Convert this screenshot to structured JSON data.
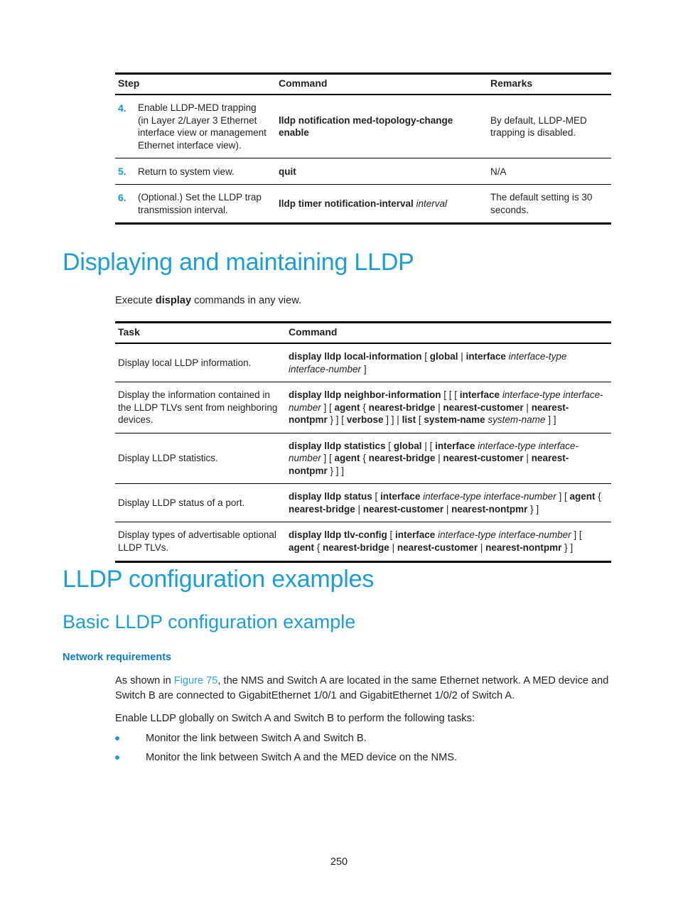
{
  "page": {
    "number": "250"
  },
  "steps_table": {
    "columns": [
      "Step",
      "Command",
      "Remarks"
    ],
    "rows": [
      {
        "num": "4.",
        "step": "Enable LLDP-MED trapping (in Layer 2/Layer 3 Ethernet interface view or management Ethernet interface view).",
        "command": "lldp notification med-topology-change enable",
        "remarks": "By default, LLDP-MED trapping is disabled."
      },
      {
        "num": "5.",
        "step": "Return to system view.",
        "command": "quit",
        "remarks": "N/A"
      },
      {
        "num": "6.",
        "step": "(Optional.) Set the LLDP trap transmission interval.",
        "command_bold": "lldp timer notification-interval",
        "command_var": "interval",
        "remarks": "The default setting is 30 seconds."
      }
    ]
  },
  "section_display": {
    "heading": "Displaying and maintaining LLDP",
    "intro_pre": "Execute ",
    "intro_bold": "display",
    "intro_post": " commands in any view."
  },
  "display_table": {
    "columns": [
      "Task",
      "Command"
    ],
    "rows": [
      {
        "task": "Display local LLDP information.",
        "command_parts": [
          {
            "t": "display lldp local-information",
            "s": "b"
          },
          {
            "t": " [ ",
            "s": "n"
          },
          {
            "t": "global",
            "s": "b"
          },
          {
            "t": " | ",
            "s": "n"
          },
          {
            "t": "interface",
            "s": "b"
          },
          {
            "t": " ",
            "s": "n"
          },
          {
            "t": "interface-type interface-number",
            "s": "i"
          },
          {
            "t": " ]",
            "s": "n"
          }
        ]
      },
      {
        "task": "Display the information contained in the LLDP TLVs sent from neighboring devices.",
        "command_parts": [
          {
            "t": "display lldp neighbor-information",
            "s": "b"
          },
          {
            "t": " [ [ [ ",
            "s": "n"
          },
          {
            "t": "interface",
            "s": "b"
          },
          {
            "t": " ",
            "s": "n"
          },
          {
            "t": "interface-type interface-number",
            "s": "i"
          },
          {
            "t": " ] [ ",
            "s": "n"
          },
          {
            "t": "agent",
            "s": "b"
          },
          {
            "t": " { ",
            "s": "n"
          },
          {
            "t": "nearest-bridge",
            "s": "b"
          },
          {
            "t": " | ",
            "s": "n"
          },
          {
            "t": "nearest-customer",
            "s": "b"
          },
          {
            "t": " | ",
            "s": "n"
          },
          {
            "t": "nearest-nontpmr",
            "s": "b"
          },
          {
            "t": " } ] [ ",
            "s": "n"
          },
          {
            "t": "verbose",
            "s": "b"
          },
          {
            "t": " ] ] | ",
            "s": "n"
          },
          {
            "t": "list",
            "s": "b"
          },
          {
            "t": " [ ",
            "s": "n"
          },
          {
            "t": "system-name",
            "s": "b"
          },
          {
            "t": " ",
            "s": "n"
          },
          {
            "t": "system-name",
            "s": "i"
          },
          {
            "t": " ] ]",
            "s": "n"
          }
        ]
      },
      {
        "task": "Display LLDP statistics.",
        "command_parts": [
          {
            "t": "display lldp statistics",
            "s": "b"
          },
          {
            "t": " [ ",
            "s": "n"
          },
          {
            "t": "global",
            "s": "b"
          },
          {
            "t": " | [ ",
            "s": "n"
          },
          {
            "t": "interface",
            "s": "b"
          },
          {
            "t": " ",
            "s": "n"
          },
          {
            "t": "interface-type interface-number",
            "s": "i"
          },
          {
            "t": " ] [ ",
            "s": "n"
          },
          {
            "t": "agent",
            "s": "b"
          },
          {
            "t": " { ",
            "s": "n"
          },
          {
            "t": "nearest-bridge",
            "s": "b"
          },
          {
            "t": " | ",
            "s": "n"
          },
          {
            "t": "nearest-customer",
            "s": "b"
          },
          {
            "t": " | ",
            "s": "n"
          },
          {
            "t": "nearest-nontpmr",
            "s": "b"
          },
          {
            "t": " } ] ]",
            "s": "n"
          }
        ]
      },
      {
        "task": "Display LLDP status of a port.",
        "command_parts": [
          {
            "t": "display lldp status",
            "s": "b"
          },
          {
            "t": " [ ",
            "s": "n"
          },
          {
            "t": "interface",
            "s": "b"
          },
          {
            "t": " ",
            "s": "n"
          },
          {
            "t": "interface-type interface-number",
            "s": "i"
          },
          {
            "t": " ] [ ",
            "s": "n"
          },
          {
            "t": "agent",
            "s": "b"
          },
          {
            "t": " { ",
            "s": "n"
          },
          {
            "t": "nearest-bridge",
            "s": "b"
          },
          {
            "t": " | ",
            "s": "n"
          },
          {
            "t": "nearest-customer",
            "s": "b"
          },
          {
            "t": " | ",
            "s": "n"
          },
          {
            "t": "nearest-nontpmr",
            "s": "b"
          },
          {
            "t": " } ]",
            "s": "n"
          }
        ]
      },
      {
        "task": "Display types of advertisable optional LLDP TLVs.",
        "command_parts": [
          {
            "t": "display lldp tlv-config",
            "s": "b"
          },
          {
            "t": " [ ",
            "s": "n"
          },
          {
            "t": "interface",
            "s": "b"
          },
          {
            "t": " ",
            "s": "n"
          },
          {
            "t": "interface-type interface-number",
            "s": "i"
          },
          {
            "t": " ] [ ",
            "s": "n"
          },
          {
            "t": "agent",
            "s": "b"
          },
          {
            "t": " { ",
            "s": "n"
          },
          {
            "t": "nearest-bridge",
            "s": "b"
          },
          {
            "t": " | ",
            "s": "n"
          },
          {
            "t": "nearest-customer",
            "s": "b"
          },
          {
            "t": " | ",
            "s": "n"
          },
          {
            "t": "nearest-nontpmr",
            "s": "b"
          },
          {
            "t": " } ]",
            "s": "n"
          }
        ]
      }
    ]
  },
  "section_examples": {
    "heading": "LLDP configuration examples",
    "sub_heading": "Basic LLDP configuration example",
    "sub_sub_heading": "Network requirements",
    "para1_pre": "As shown in ",
    "para1_link": "Figure 75",
    "para1_post": ", the NMS and Switch A are located in the same Ethernet network. A MED device and Switch B are connected to GigabitEthernet 1/0/1 and GigabitEthernet 1/0/2 of Switch A.",
    "para2": "Enable LLDP globally on Switch A and Switch B to perform the following tasks:",
    "bullets": [
      "Monitor the link between Switch A and Switch B.",
      "Monitor the link between Switch A and the MED device on the NMS."
    ]
  },
  "colors": {
    "heading_blue": "#1b9dd9",
    "sub_heading_blue": "#0d7fc0",
    "link_blue": "#2aa7e0",
    "step_number_blue": "#0b9ad6",
    "body_text": "#231f20"
  }
}
